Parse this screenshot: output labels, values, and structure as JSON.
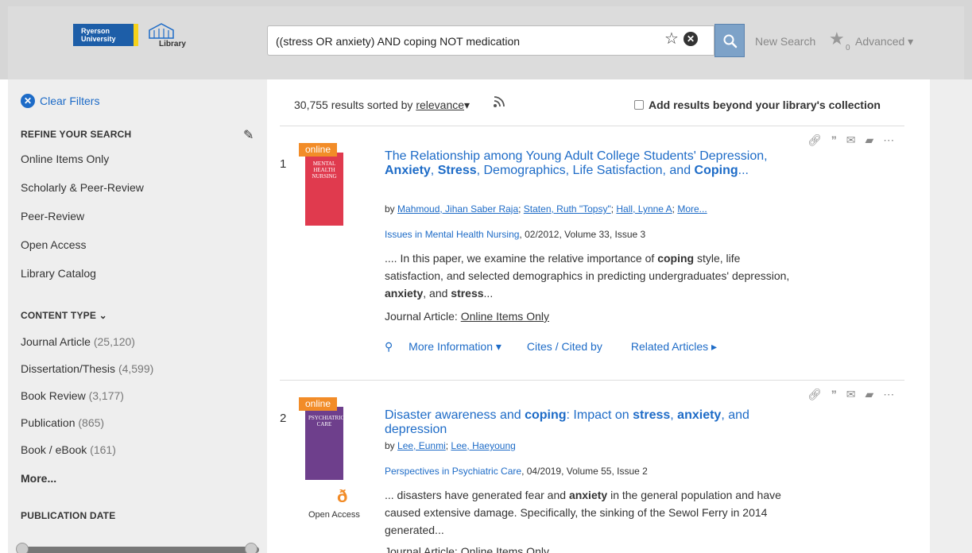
{
  "header": {
    "logo_ryerson": "Ryerson University",
    "logo_library": "Library",
    "search_value": "((stress OR anxiety) AND coping NOT medication",
    "new_search": "New Search",
    "saved_count": "0",
    "advanced": "Advanced ▾"
  },
  "sidebar": {
    "clear_filters": "Clear Filters",
    "refine_heading": "REFINE YOUR SEARCH",
    "refine_items": [
      "Online Items Only",
      "Scholarly & Peer-Review",
      "Peer-Review",
      "Open Access",
      "Library Catalog"
    ],
    "content_type_heading": "CONTENT TYPE ⌄",
    "content_types": [
      {
        "label": "Journal Article",
        "count": "(25,120)"
      },
      {
        "label": "Dissertation/Thesis",
        "count": "(4,599)"
      },
      {
        "label": "Book Review",
        "count": "(3,177)"
      },
      {
        "label": "Publication",
        "count": "(865)"
      },
      {
        "label": "Book / eBook",
        "count": "(161)"
      }
    ],
    "more": "More...",
    "publication_date_heading": "PUBLICATION DATE"
  },
  "results_bar": {
    "count_text": "30,755 results sorted by",
    "sort": "relevance",
    "beyond_label": "Add results beyond your library's collection"
  },
  "results": [
    {
      "num": "1",
      "badge": "online",
      "cover_text": "MENTAL HEALTH NURSING",
      "title_parts": [
        "The Relationship among Young Adult College Students' Depression, ",
        "Anxiety",
        ", ",
        "Stress",
        ", Demographics, Life Satisfaction, and ",
        "Coping",
        "..."
      ],
      "by": "by",
      "authors": [
        "Mahmoud, Jihan Saber Raja",
        "Staten, Ruth \"Topsy\"",
        "Hall, Lynne A",
        "More..."
      ],
      "journal": "Issues in Mental Health Nursing",
      "source_rest": ", 02/2012, Volume 33, Issue 3",
      "snippet_parts": [
        ".... In this paper, we examine the relative importance of ",
        "coping",
        " style, life satisfaction, and selected demographics in predicting undergraduates' depression, ",
        "anxiety",
        ", and ",
        "stress",
        "..."
      ],
      "type_prefix": "Journal Article:",
      "type_link": "Online Items Only",
      "more_info": "More Information ▾",
      "cites": "Cites / Cited by",
      "related": "Related Articles ▸"
    },
    {
      "num": "2",
      "badge": "online",
      "cover_text": "PSYCHIATRIC CARE",
      "title_parts": [
        "Disaster awareness and ",
        "coping",
        ": Impact on ",
        "stress",
        ", ",
        "anxiety",
        ", and depression"
      ],
      "by": "by",
      "authors": [
        "Lee, Eunmi",
        "Lee, Haeyoung"
      ],
      "journal": "Perspectives in Psychiatric Care",
      "source_rest": ", 04/2019, Volume 55, Issue 2",
      "snippet_parts": [
        "... disasters have generated fear and ",
        "anxiety",
        " in the general population and have caused extensive damage. Specifically, the sinking of the Sewol Ferry in 2014 generated..."
      ],
      "open_access": "Open Access",
      "type_prefix": "Journal Article: Online Items Only"
    }
  ],
  "colors": {
    "link": "#1d6bc7",
    "badge": "#f28c28",
    "search_button": "#7da2c8"
  }
}
